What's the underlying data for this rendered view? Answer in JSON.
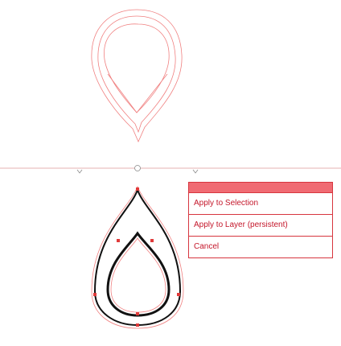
{
  "menu": {
    "items": [
      {
        "label": "Apply to Selection"
      },
      {
        "label": "Apply to Layer (persistent)"
      },
      {
        "label": "Cancel"
      }
    ]
  },
  "colors": {
    "accent": "#d7363f",
    "header_fill": "#f06b73",
    "menu_text": "#c4162a",
    "stroke_light": "#f08080",
    "stroke_dark": "#111111"
  },
  "icons": [
    "divider-marker-icon",
    "divider-handle-icon"
  ]
}
